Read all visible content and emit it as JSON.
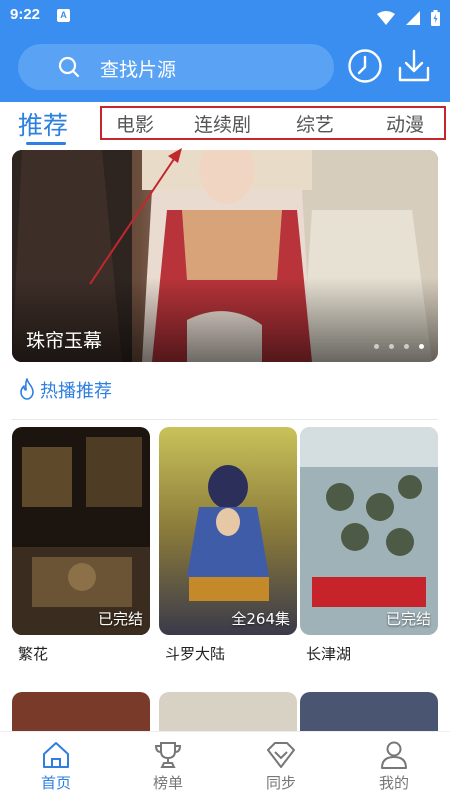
{
  "status_bar": {
    "time": "9:22",
    "notification_icon": "A"
  },
  "header": {
    "search_placeholder": "查找片源",
    "history_icon": "clock-icon",
    "download_icon": "download-icon"
  },
  "tabs": {
    "active": "推荐",
    "items": [
      "电影",
      "连续剧",
      "综艺",
      "动漫"
    ]
  },
  "banner": {
    "title": "珠帘玉幕",
    "dot_count": 4,
    "active_dot": 3
  },
  "section": {
    "title": "热播推荐",
    "icon": "flame-icon"
  },
  "cards": [
    {
      "title": "繁花",
      "badge": "已完结"
    },
    {
      "title": "斗罗大陆",
      "badge": "全264集"
    },
    {
      "title": "长津湖",
      "badge": "已完结"
    }
  ],
  "bottom_nav": [
    {
      "label": "首页",
      "icon": "home-icon",
      "active": true
    },
    {
      "label": "榜单",
      "icon": "trophy-icon",
      "active": false
    },
    {
      "label": "同步",
      "icon": "diamond-icon",
      "active": false
    },
    {
      "label": "我的",
      "icon": "user-icon",
      "active": false
    }
  ],
  "colors": {
    "primary": "#3a8ef0",
    "accent": "#2d7fe0",
    "annotation": "#c2272d"
  }
}
